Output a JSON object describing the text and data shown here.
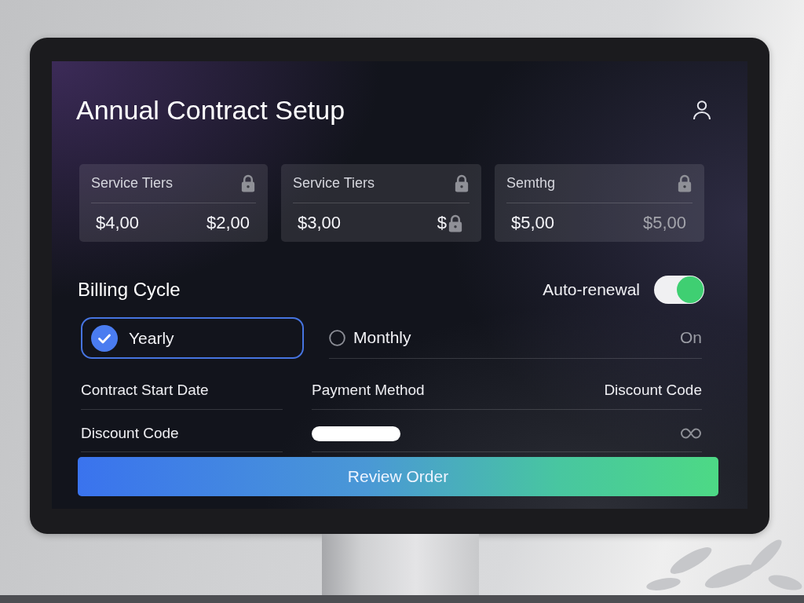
{
  "screen": {
    "title": "Annual Contract Setup",
    "tier_cards": [
      {
        "label": "Service Tiers",
        "price": "$4,00",
        "second": {
          "text": "$2,00",
          "muted": false,
          "locked": false
        }
      },
      {
        "label": "Service Tiers",
        "price": "$3,00",
        "second": {
          "text": "$",
          "muted": false,
          "locked": true
        }
      },
      {
        "label": "Semthg",
        "price": "$5,00",
        "second": {
          "text": "$5,00",
          "muted": true,
          "locked": false
        }
      }
    ],
    "billing_cycle": {
      "heading": "Billing Cycle",
      "options": [
        {
          "label": "Yearly",
          "selected": true
        },
        {
          "label": "Monthly",
          "selected": false
        }
      ]
    },
    "auto_renewal": {
      "label": "Auto-renewal",
      "on": true,
      "status": "On"
    },
    "details": {
      "rows": [
        {
          "label": "Contract Start Date",
          "cells": [
            {
              "kind": "text",
              "text": "Payment Method"
            },
            {
              "kind": "text",
              "text": "Discount Code"
            }
          ]
        },
        {
          "label": "Discount Code",
          "cells": [
            {
              "kind": "field"
            },
            {
              "kind": "icon"
            }
          ]
        }
      ]
    },
    "review_button": {
      "label": "Review Order"
    }
  }
}
